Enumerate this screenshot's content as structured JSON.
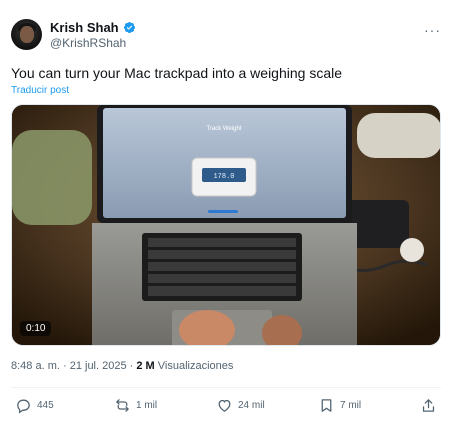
{
  "author": {
    "display_name": "Krish Shah",
    "handle": "@KrishRShah",
    "verified_icon": "verified-badge-icon"
  },
  "tweet": {
    "text": "You can turn your Mac trackpad into a weighing scale",
    "translate_label": "Traducir post"
  },
  "media": {
    "duration": "0:10",
    "screen_title": "Track Weight",
    "scale_reading": "178.0"
  },
  "meta": {
    "time": "8:48 a. m.",
    "separator": " · ",
    "date": "21 jul. 2025",
    "separator2": " · ",
    "views_count": "2 M",
    "views_label": " Visualizaciones"
  },
  "actions": {
    "replies": "445",
    "reposts": "1 mil",
    "likes": "24 mil",
    "bookmarks": "7 mil"
  },
  "colors": {
    "accent": "#1d9bf0",
    "text": "#0f1419",
    "muted": "#536471"
  }
}
